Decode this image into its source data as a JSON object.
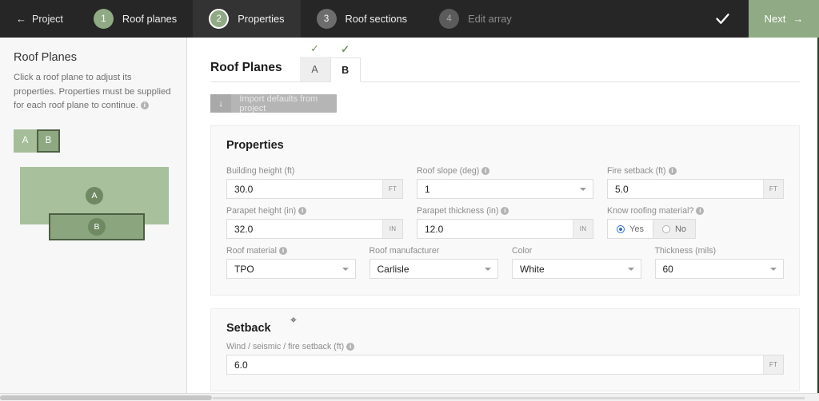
{
  "topnav": {
    "back_label": "Project",
    "back_icon": "arrow-left-icon",
    "steps": [
      {
        "number": "1",
        "label": "Roof planes",
        "state": "done"
      },
      {
        "number": "2",
        "label": "Properties",
        "state": "current"
      },
      {
        "number": "3",
        "label": "Roof sections",
        "state": "todo"
      },
      {
        "number": "4",
        "label": "Edit array",
        "state": "disabled"
      }
    ],
    "confirm_icon": "check-icon",
    "next_label": "Next",
    "next_icon": "arrow-right-icon",
    "accent_color": "#8faa84",
    "background_color": "#262626"
  },
  "sidebar": {
    "title": "Roof Planes",
    "description": "Click a roof plane to adjust its properties. Properties must be supplied for each roof plane to continue.",
    "description_info_icon": "info-icon",
    "chips": [
      {
        "label": "A",
        "selected": false
      },
      {
        "label": "B",
        "selected": true
      }
    ],
    "roof_map": {
      "planes": [
        {
          "label": "A",
          "selected": false
        },
        {
          "label": "B",
          "selected": true
        }
      ]
    }
  },
  "main": {
    "tabs_title": "Roof Planes",
    "tabs": [
      {
        "label": "A",
        "active": false,
        "complete_icon": "check-icon"
      },
      {
        "label": "B",
        "active": true,
        "complete_icon": "check-icon"
      }
    ],
    "import_button": {
      "label": "Import defaults from project",
      "icon": "download-arrow-icon"
    },
    "properties": {
      "title": "Properties",
      "building_height": {
        "label": "Building height (ft)",
        "value": "30.0",
        "unit": "FT",
        "placeholder": ""
      },
      "roof_slope": {
        "label": "Roof slope (deg)",
        "value": "1",
        "info_icon": "info-icon"
      },
      "fire_setback": {
        "label": "Fire setback (ft)",
        "value": "5.0",
        "unit": "FT",
        "info_icon": "info-icon",
        "placeholder": ""
      },
      "parapet_height": {
        "label": "Parapet height (in)",
        "value": "32.0",
        "unit": "IN",
        "info_icon": "info-icon",
        "placeholder": ""
      },
      "parapet_thickness": {
        "label": "Parapet thickness (in)",
        "value": "12.0",
        "unit": "IN",
        "info_icon": "info-icon",
        "placeholder": ""
      },
      "know_roofing_material": {
        "label": "Know roofing material?",
        "info_icon": "info-icon",
        "yes_label": "Yes",
        "no_label": "No",
        "selected": "Yes"
      },
      "roof_material": {
        "label": "Roof material",
        "value": "TPO",
        "info_icon": "info-icon"
      },
      "roof_manufacturer": {
        "label": "Roof manufacturer",
        "value": "Carlisle"
      },
      "color": {
        "label": "Color",
        "value": "White"
      },
      "thickness": {
        "label": "Thickness (mils)",
        "value": "60"
      }
    },
    "setback": {
      "title": "Setback",
      "wind_seismic_fire": {
        "label": "Wind / seismic / fire setback (ft)",
        "value": "6.0",
        "unit": "FT",
        "info_icon": "info-icon",
        "placeholder": ""
      }
    }
  }
}
